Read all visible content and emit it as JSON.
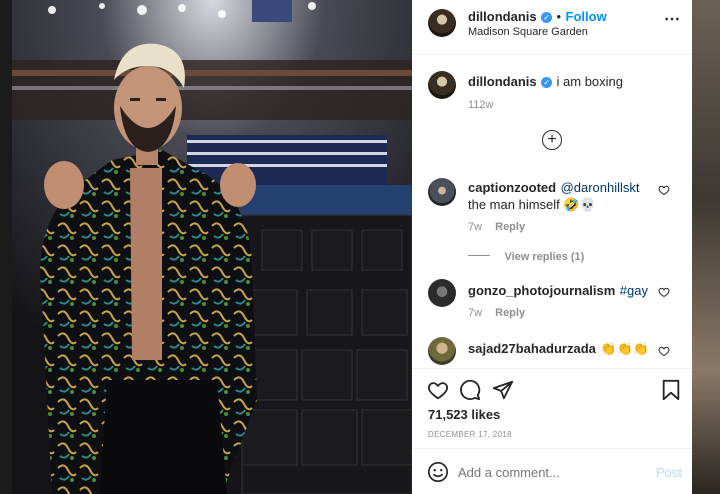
{
  "header": {
    "username": "dillondanis",
    "separator": "•",
    "follow_label": "Follow",
    "location": "Madison Square Garden",
    "more_glyph": "⋯"
  },
  "caption": {
    "username": "dillondanis",
    "text": "i am boxing",
    "age": "112w"
  },
  "load_more_glyph": "+",
  "comments": [
    {
      "username": "captionzooted",
      "mention": "@daronhillskt",
      "text": " the man himself 🤣💀",
      "age": "7w",
      "reply_label": "Reply",
      "view_replies": "View replies (1)"
    },
    {
      "username": "gonzo_photojournalism",
      "mention": "#gay",
      "text": "",
      "age": "7w",
      "reply_label": "Reply"
    },
    {
      "username": "sajad27bahadurzada",
      "text": "👏👏👏"
    }
  ],
  "actions": {
    "likes": "71,523 likes",
    "date": "DECEMBER 17, 2018"
  },
  "add_comment": {
    "placeholder": "Add a comment...",
    "post_label": "Post"
  },
  "icons": [
    "verified-icon",
    "more-options-icon",
    "load-more-icon",
    "heart-icon",
    "comment-icon",
    "share-icon",
    "bookmark-icon",
    "emoji-icon"
  ],
  "colors": {
    "accent": "#0095f6",
    "mention": "#00376b",
    "verified": "#3897f0",
    "muted": "#8e8e8e"
  }
}
